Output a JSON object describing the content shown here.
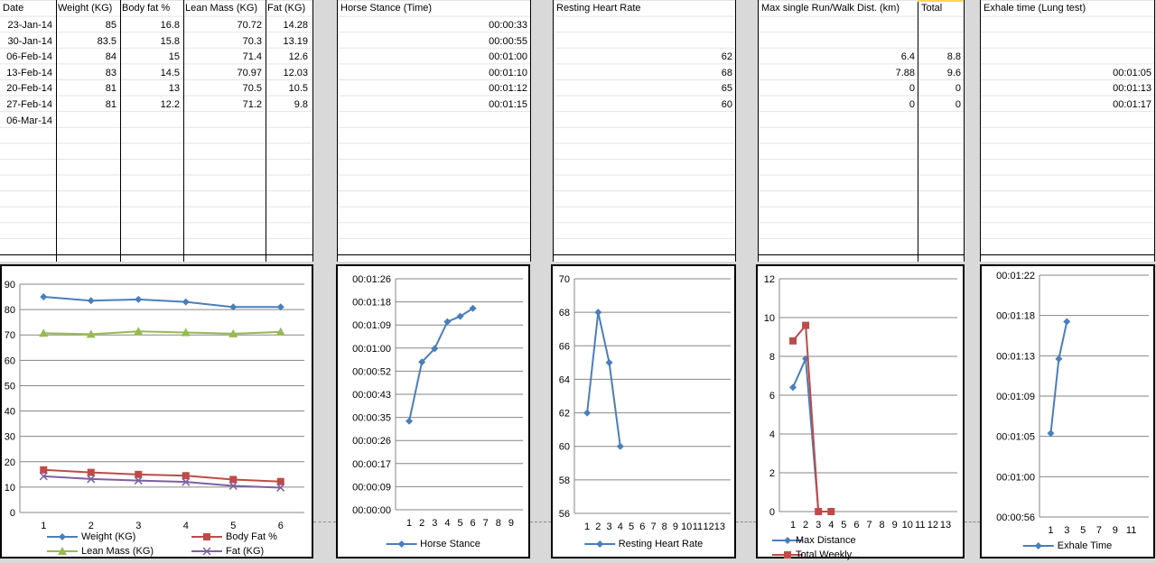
{
  "body_table": {
    "headers": [
      "Date",
      "Weight (KG)",
      "Body fat %",
      "Lean Mass (KG)",
      "Fat (KG)"
    ],
    "rows": [
      [
        "23-Jan-14",
        "85",
        "16.8",
        "70.72",
        "14.28"
      ],
      [
        "30-Jan-14",
        "83.5",
        "15.8",
        "70.3",
        "13.19"
      ],
      [
        "06-Feb-14",
        "84",
        "15",
        "71.4",
        "12.6"
      ],
      [
        "13-Feb-14",
        "83",
        "14.5",
        "70.97",
        "12.03"
      ],
      [
        "20-Feb-14",
        "81",
        "13",
        "70.5",
        "10.5"
      ],
      [
        "27-Feb-14",
        "81",
        "12.2",
        "71.2",
        "9.8"
      ],
      [
        "06-Mar-14",
        "",
        "",
        "",
        ""
      ]
    ]
  },
  "horse_table": {
    "header": "Horse Stance (Time)",
    "rows": [
      "00:00:33",
      "00:00:55",
      "00:01:00",
      "00:01:10",
      "00:01:12",
      "00:01:15"
    ]
  },
  "heart_table": {
    "header": "Resting Heart Rate",
    "rows": [
      "",
      "",
      "62",
      "68",
      "65",
      "60"
    ]
  },
  "run_table": {
    "headers": [
      "Max single Run/Walk Dist. (km)",
      "Total"
    ],
    "rows": [
      [
        "",
        ""
      ],
      [
        "",
        ""
      ],
      [
        "6.4",
        "8.8"
      ],
      [
        "7.88",
        "9.6"
      ],
      [
        "0",
        "0"
      ],
      [
        "0",
        "0"
      ]
    ]
  },
  "exhale_table": {
    "header": "Exhale time (Lung test)",
    "rows": [
      "",
      "",
      "",
      "00:01:05",
      "00:01:13",
      "00:01:17"
    ]
  },
  "chart_data": [
    {
      "type": "line",
      "x": [
        1,
        2,
        3,
        4,
        5,
        6
      ],
      "ylim": [
        0,
        90
      ],
      "yticks": [
        "0",
        "10",
        "20",
        "30",
        "40",
        "50",
        "60",
        "70",
        "80",
        "90"
      ],
      "xticks": [
        "1",
        "2",
        "3",
        "4",
        "5",
        "6"
      ],
      "series": [
        {
          "name": "Weight (KG)",
          "color": "#4a7ebb",
          "marker": "diamond",
          "values": [
            85,
            83.5,
            84,
            83,
            81,
            81
          ]
        },
        {
          "name": "Body Fat %",
          "color": "#be4b48",
          "marker": "square",
          "values": [
            16.8,
            15.8,
            15,
            14.5,
            13,
            12.2
          ]
        },
        {
          "name": "Lean Mass (KG)",
          "color": "#98b954",
          "marker": "triangle",
          "values": [
            70.72,
            70.3,
            71.4,
            70.97,
            70.5,
            71.2
          ]
        },
        {
          "name": "Fat (KG)",
          "color": "#7d60a0",
          "marker": "x",
          "values": [
            14.28,
            13.19,
            12.6,
            12.03,
            10.5,
            9.8
          ]
        }
      ]
    },
    {
      "type": "line",
      "ylim": [
        0,
        86
      ],
      "yticks": [
        "00:00:00",
        "00:00:09",
        "00:00:17",
        "00:00:26",
        "00:00:35",
        "00:00:43",
        "00:00:52",
        "00:01:00",
        "00:01:09",
        "00:01:18",
        "00:01:26"
      ],
      "xticks": [
        "1",
        "2",
        "3",
        "4",
        "5",
        "6",
        "7",
        "8",
        "9"
      ],
      "series": [
        {
          "name": "Horse Stance",
          "color": "#4a7ebb",
          "marker": "diamond",
          "x": [
            1,
            2,
            3,
            4,
            5,
            6
          ],
          "values": [
            33,
            55,
            60,
            70,
            72,
            75
          ]
        }
      ]
    },
    {
      "type": "line",
      "ylim": [
        56,
        70
      ],
      "yticks": [
        "56",
        "58",
        "60",
        "62",
        "64",
        "66",
        "68",
        "70"
      ],
      "xticks": [
        "1",
        "2",
        "3",
        "4",
        "5",
        "6",
        "7",
        "8",
        "9",
        "10",
        "11",
        "12",
        "13"
      ],
      "series": [
        {
          "name": "Resting Heart Rate",
          "color": "#4a7ebb",
          "marker": "diamond",
          "x": [
            1,
            2,
            3,
            4
          ],
          "values": [
            62,
            68,
            65,
            60
          ]
        }
      ]
    },
    {
      "type": "line",
      "ylim": [
        0,
        12
      ],
      "yticks": [
        "0",
        "2",
        "4",
        "6",
        "8",
        "10",
        "12"
      ],
      "xticks": [
        "1",
        "2",
        "3",
        "4",
        "5",
        "6",
        "7",
        "8",
        "9",
        "10",
        "11",
        "12",
        "13"
      ],
      "series": [
        {
          "name": "Max Distance",
          "color": "#4a7ebb",
          "marker": "diamond",
          "x": [
            1,
            2,
            3,
            4
          ],
          "values": [
            6.4,
            7.88,
            0,
            0
          ]
        },
        {
          "name": "Total Weekly...",
          "color": "#be4b48",
          "marker": "square",
          "x": [
            1,
            2,
            3,
            4
          ],
          "values": [
            8.8,
            9.6,
            0,
            0
          ]
        }
      ]
    },
    {
      "type": "line",
      "ylim": [
        56,
        82
      ],
      "yticks": [
        "00:00:56",
        "00:01:00",
        "00:01:05",
        "00:01:09",
        "00:01:13",
        "00:01:18",
        "00:01:22"
      ],
      "xticks": [
        "1",
        "3",
        "5",
        "7",
        "9",
        "11"
      ],
      "series": [
        {
          "name": "Exhale Time",
          "color": "#4a7ebb",
          "marker": "diamond",
          "x": [
            1,
            2,
            3
          ],
          "values": [
            65,
            73,
            77
          ]
        }
      ]
    }
  ]
}
